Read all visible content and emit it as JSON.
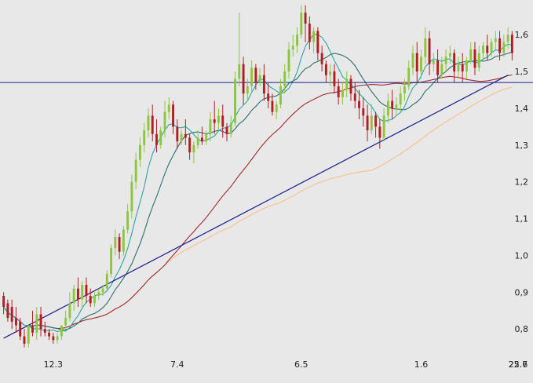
{
  "chart_data": {
    "type": "candlestick",
    "title": "",
    "xlabel": "",
    "ylabel": "",
    "grid": false,
    "ylim": [
      0.73,
      1.69
    ],
    "x_ticks": [
      "12.3",
      "7.4",
      "6.5",
      "1.6",
      "25.6",
      "22.7"
    ],
    "y_ticks": [
      "0,8",
      "0,9",
      "1,0",
      "1,1",
      "1,2",
      "1,3",
      "1,4",
      "1,5",
      "1,6"
    ],
    "colors": {
      "up": "#8cc63f",
      "down": "#b01e23",
      "ma_short": "#2aa6a6",
      "ma_mid": "#2a6e6a",
      "ma_long": "#a0292e",
      "ma_longest": "#f5c08c",
      "trendline": "#1c1c8c",
      "hline": "#1c1c8c",
      "background": "#e8e8e8"
    },
    "horizontal_level": 1.47,
    "trendline": [
      [
        0,
        0.775
      ],
      [
        122,
        1.49
      ]
    ],
    "candles": [
      [
        0.89,
        0.9,
        0.86,
        0.84
      ],
      [
        0.87,
        0.88,
        0.83,
        0.82
      ],
      [
        0.86,
        0.88,
        0.82,
        0.8
      ],
      [
        0.83,
        0.86,
        0.81,
        0.79
      ],
      [
        0.82,
        0.83,
        0.78,
        0.77
      ],
      [
        0.78,
        0.8,
        0.76,
        0.75
      ],
      [
        0.76,
        0.78,
        0.81,
        0.75
      ],
      [
        0.81,
        0.85,
        0.79,
        0.78
      ],
      [
        0.79,
        0.86,
        0.84,
        0.77
      ],
      [
        0.84,
        0.86,
        0.8,
        0.78
      ],
      [
        0.8,
        0.82,
        0.79,
        0.78
      ],
      [
        0.79,
        0.8,
        0.78,
        0.77
      ],
      [
        0.78,
        0.79,
        0.77,
        0.76
      ],
      [
        0.77,
        0.79,
        0.78,
        0.76
      ],
      [
        0.78,
        0.8,
        0.81,
        0.77
      ],
      [
        0.81,
        0.85,
        0.83,
        0.8
      ],
      [
        0.83,
        0.9,
        0.87,
        0.82
      ],
      [
        0.87,
        0.92,
        0.91,
        0.85
      ],
      [
        0.91,
        0.94,
        0.88,
        0.86
      ],
      [
        0.88,
        0.93,
        0.92,
        0.86
      ],
      [
        0.92,
        0.94,
        0.89,
        0.87
      ],
      [
        0.89,
        0.91,
        0.87,
        0.86
      ],
      [
        0.87,
        0.9,
        0.89,
        0.86
      ],
      [
        0.89,
        0.91,
        0.9,
        0.88
      ],
      [
        0.9,
        0.92,
        0.91,
        0.89
      ],
      [
        0.91,
        0.96,
        0.95,
        0.9
      ],
      [
        0.95,
        1.03,
        1.02,
        0.94
      ],
      [
        1.02,
        1.07,
        1.05,
        1.0
      ],
      [
        1.05,
        1.06,
        1.01,
        0.99
      ],
      [
        1.01,
        1.08,
        1.07,
        1.0
      ],
      [
        1.07,
        1.14,
        1.12,
        1.06
      ],
      [
        1.12,
        1.22,
        1.2,
        1.1
      ],
      [
        1.2,
        1.28,
        1.26,
        1.18
      ],
      [
        1.26,
        1.32,
        1.3,
        1.24
      ],
      [
        1.3,
        1.36,
        1.34,
        1.28
      ],
      [
        1.34,
        1.4,
        1.38,
        1.32
      ],
      [
        1.38,
        1.41,
        1.33,
        1.31
      ],
      [
        1.33,
        1.37,
        1.3,
        1.28
      ],
      [
        1.3,
        1.35,
        1.34,
        1.29
      ],
      [
        1.34,
        1.42,
        1.39,
        1.32
      ],
      [
        1.39,
        1.43,
        1.41,
        1.37
      ],
      [
        1.41,
        1.42,
        1.35,
        1.33
      ],
      [
        1.35,
        1.37,
        1.31,
        1.29
      ],
      [
        1.31,
        1.34,
        1.33,
        1.3
      ],
      [
        1.33,
        1.37,
        1.32,
        1.3
      ],
      [
        1.32,
        1.33,
        1.28,
        1.26
      ],
      [
        1.28,
        1.31,
        1.3,
        1.25
      ],
      [
        1.3,
        1.34,
        1.32,
        1.29
      ],
      [
        1.32,
        1.35,
        1.31,
        1.3
      ],
      [
        1.31,
        1.34,
        1.33,
        1.3
      ],
      [
        1.33,
        1.39,
        1.37,
        1.31
      ],
      [
        1.37,
        1.42,
        1.36,
        1.33
      ],
      [
        1.36,
        1.4,
        1.38,
        1.34
      ],
      [
        1.38,
        1.41,
        1.35,
        1.32
      ],
      [
        1.35,
        1.36,
        1.33,
        1.31
      ],
      [
        1.33,
        1.38,
        1.36,
        1.32
      ],
      [
        1.36,
        1.5,
        1.48,
        1.35
      ],
      [
        1.48,
        1.66,
        1.52,
        1.46
      ],
      [
        1.52,
        1.54,
        1.44,
        1.41
      ],
      [
        1.44,
        1.48,
        1.46,
        1.42
      ],
      [
        1.46,
        1.53,
        1.51,
        1.44
      ],
      [
        1.51,
        1.52,
        1.47,
        1.45
      ],
      [
        1.47,
        1.51,
        1.49,
        1.46
      ],
      [
        1.49,
        1.52,
        1.44,
        1.42
      ],
      [
        1.44,
        1.47,
        1.42,
        1.4
      ],
      [
        1.42,
        1.44,
        1.39,
        1.38
      ],
      [
        1.39,
        1.42,
        1.41,
        1.37
      ],
      [
        1.41,
        1.48,
        1.46,
        1.4
      ],
      [
        1.46,
        1.52,
        1.5,
        1.44
      ],
      [
        1.5,
        1.58,
        1.56,
        1.48
      ],
      [
        1.56,
        1.6,
        1.57,
        1.54
      ],
      [
        1.57,
        1.62,
        1.6,
        1.55
      ],
      [
        1.6,
        1.68,
        1.66,
        1.59
      ],
      [
        1.66,
        1.68,
        1.63,
        1.58
      ],
      [
        1.63,
        1.65,
        1.58,
        1.56
      ],
      [
        1.58,
        1.62,
        1.61,
        1.55
      ],
      [
        1.61,
        1.62,
        1.55,
        1.53
      ],
      [
        1.55,
        1.57,
        1.52,
        1.5
      ],
      [
        1.52,
        1.53,
        1.49,
        1.47
      ],
      [
        1.49,
        1.52,
        1.5,
        1.46
      ],
      [
        1.5,
        1.52,
        1.46,
        1.44
      ],
      [
        1.46,
        1.48,
        1.43,
        1.41
      ],
      [
        1.43,
        1.47,
        1.45,
        1.41
      ],
      [
        1.45,
        1.5,
        1.48,
        1.43
      ],
      [
        1.48,
        1.49,
        1.44,
        1.42
      ],
      [
        1.44,
        1.47,
        1.42,
        1.4
      ],
      [
        1.42,
        1.45,
        1.4,
        1.37
      ],
      [
        1.4,
        1.43,
        1.38,
        1.35
      ],
      [
        1.38,
        1.41,
        1.34,
        1.31
      ],
      [
        1.34,
        1.41,
        1.38,
        1.33
      ],
      [
        1.38,
        1.39,
        1.35,
        1.32
      ],
      [
        1.35,
        1.37,
        1.32,
        1.29
      ],
      [
        1.32,
        1.4,
        1.38,
        1.31
      ],
      [
        1.38,
        1.44,
        1.42,
        1.36
      ],
      [
        1.42,
        1.45,
        1.4,
        1.37
      ],
      [
        1.4,
        1.43,
        1.41,
        1.38
      ],
      [
        1.41,
        1.46,
        1.44,
        1.39
      ],
      [
        1.44,
        1.48,
        1.46,
        1.42
      ],
      [
        1.46,
        1.53,
        1.51,
        1.45
      ],
      [
        1.51,
        1.57,
        1.55,
        1.49
      ],
      [
        1.55,
        1.58,
        1.5,
        1.47
      ],
      [
        1.5,
        1.56,
        1.54,
        1.48
      ],
      [
        1.54,
        1.62,
        1.59,
        1.52
      ],
      [
        1.59,
        1.61,
        1.52,
        1.49
      ],
      [
        1.52,
        1.55,
        1.53,
        1.5
      ],
      [
        1.53,
        1.56,
        1.49,
        1.47
      ],
      [
        1.49,
        1.54,
        1.52,
        1.48
      ],
      [
        1.52,
        1.56,
        1.54,
        1.5
      ],
      [
        1.54,
        1.57,
        1.55,
        1.52
      ],
      [
        1.55,
        1.56,
        1.5,
        1.47
      ],
      [
        1.5,
        1.54,
        1.52,
        1.48
      ],
      [
        1.52,
        1.55,
        1.5,
        1.47
      ],
      [
        1.5,
        1.54,
        1.53,
        1.48
      ],
      [
        1.53,
        1.58,
        1.56,
        1.52
      ],
      [
        1.56,
        1.58,
        1.51,
        1.49
      ],
      [
        1.51,
        1.57,
        1.55,
        1.5
      ],
      [
        1.55,
        1.58,
        1.57,
        1.53
      ],
      [
        1.57,
        1.6,
        1.55,
        1.53
      ],
      [
        1.55,
        1.59,
        1.58,
        1.54
      ],
      [
        1.58,
        1.61,
        1.59,
        1.56
      ],
      [
        1.59,
        1.61,
        1.55,
        1.53
      ],
      [
        1.55,
        1.6,
        1.58,
        1.54
      ],
      [
        1.58,
        1.62,
        1.6,
        1.56
      ],
      [
        1.6,
        1.61,
        1.55,
        1.53
      ]
    ],
    "x_tick_index": [
      12,
      42,
      72,
      101,
      130,
      159
    ]
  }
}
